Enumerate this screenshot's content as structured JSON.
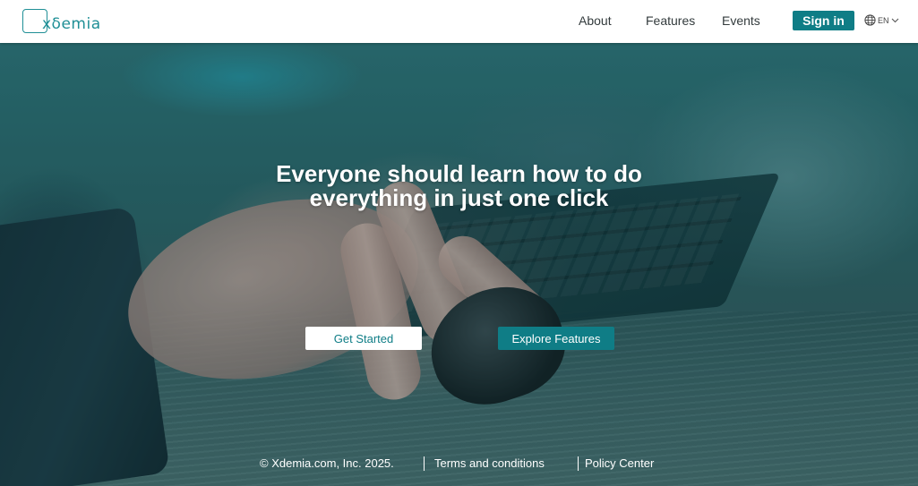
{
  "brand": {
    "logo_text": "xδemia",
    "accent_color": "#0f7d86",
    "logo_color": "#1f8f96"
  },
  "nav": {
    "items": [
      {
        "label": "About"
      },
      {
        "label": "Features"
      },
      {
        "label": "Events"
      }
    ],
    "signin_label": "Sign in",
    "language": {
      "icon": "globe-icon",
      "code": "EN",
      "dropdown_icon": "chevron-down-icon"
    }
  },
  "hero": {
    "headline_line1": "Everyone should learn how to do",
    "headline_line2": "everything in just one click",
    "primary_cta": "Get Started",
    "secondary_cta": "Explore Features"
  },
  "footer": {
    "copyright": "© Xdemia.com, Inc. 2025.",
    "terms_link": "Terms and conditions",
    "policy_link": "Policy Center"
  }
}
